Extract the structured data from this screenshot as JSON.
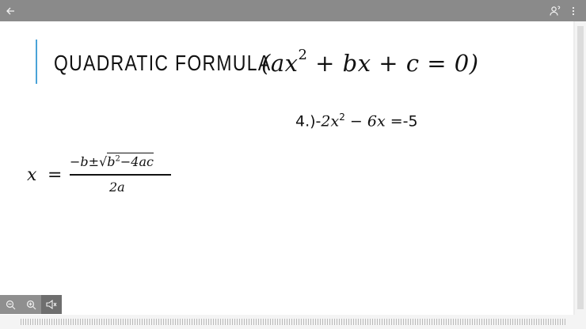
{
  "toolbar": {
    "back": "back-arrow-icon",
    "user": "person-settings-icon",
    "menu": "more-vert-icon"
  },
  "slide": {
    "title_text": "QUADRATIC FORMULA",
    "title_math": {
      "open": "(",
      "lhs_a": "ax",
      "exp": "2",
      "rest": " + bx + c = 0",
      "close": ")"
    },
    "problem": {
      "prefix": "4.)-",
      "lead": "2x",
      "exp": "2",
      "rest": " − 6x =",
      "rhs": "-5"
    },
    "formula": {
      "lhs": "x",
      "eq": "=",
      "num_left": "−b±√",
      "num_b": "b",
      "num_exp": "2",
      "num_rest": "−4ac",
      "den": "2a"
    }
  },
  "zoom_controls": [
    "zoom-out-icon",
    "zoom-in-icon",
    "speaker-icon"
  ]
}
